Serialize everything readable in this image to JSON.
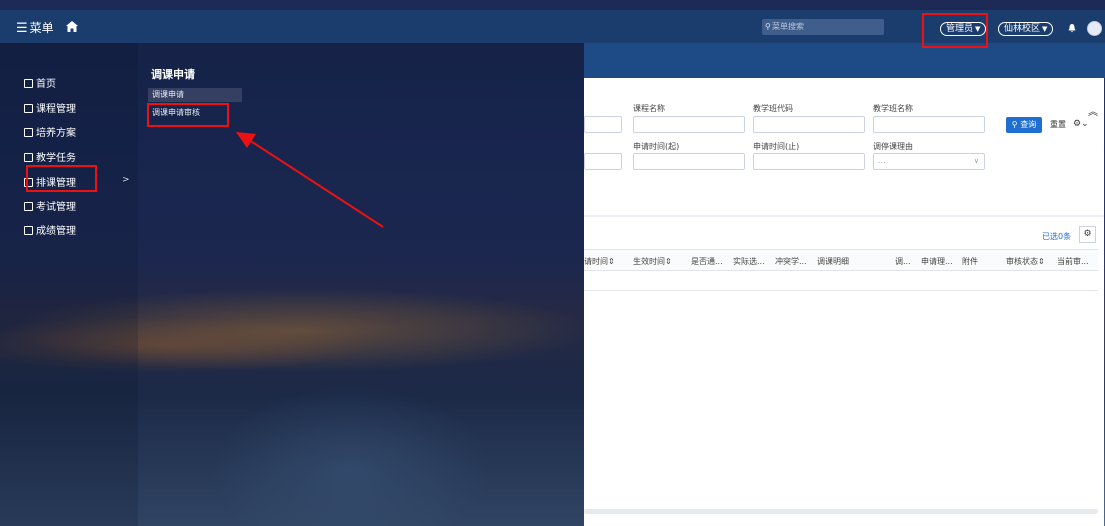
{
  "topbar": {
    "menu_label": "菜单",
    "search_placeholder": "菜单搜索",
    "role": "管理员",
    "campus": "仙林校区"
  },
  "sidebar": {
    "items": [
      {
        "label": "首页"
      },
      {
        "label": "课程管理"
      },
      {
        "label": "培养方案"
      },
      {
        "label": "教学任务"
      },
      {
        "label": "排课管理"
      },
      {
        "label": "考试管理"
      },
      {
        "label": "成绩管理"
      }
    ],
    "chevron": ">"
  },
  "submenu": {
    "title": "调课申请",
    "items": [
      {
        "label": "调课申请"
      },
      {
        "label": "调课申请审核"
      }
    ]
  },
  "filters": {
    "course_name": "课程名称",
    "class_code": "教学班代码",
    "class_name": "教学班名称",
    "apply_time_start": "申请时间(起)",
    "apply_time_end": "申请时间(止)",
    "reason": "调停课理由",
    "reason_value": "..."
  },
  "buttons": {
    "query": "查询",
    "reset": "重置"
  },
  "table": {
    "selected_count": "已选0条",
    "columns": [
      "请时间⇕",
      "生效时间⇕",
      "是否通...",
      "实际选...",
      "冲突学...",
      "调课明细",
      "调...",
      "申请理...",
      "附件",
      "审核状态⇕",
      "当前审..."
    ]
  },
  "colors": {
    "topbar": "#1a3d6e",
    "accent": "#1f6fd1",
    "annotation": "#e11111"
  }
}
